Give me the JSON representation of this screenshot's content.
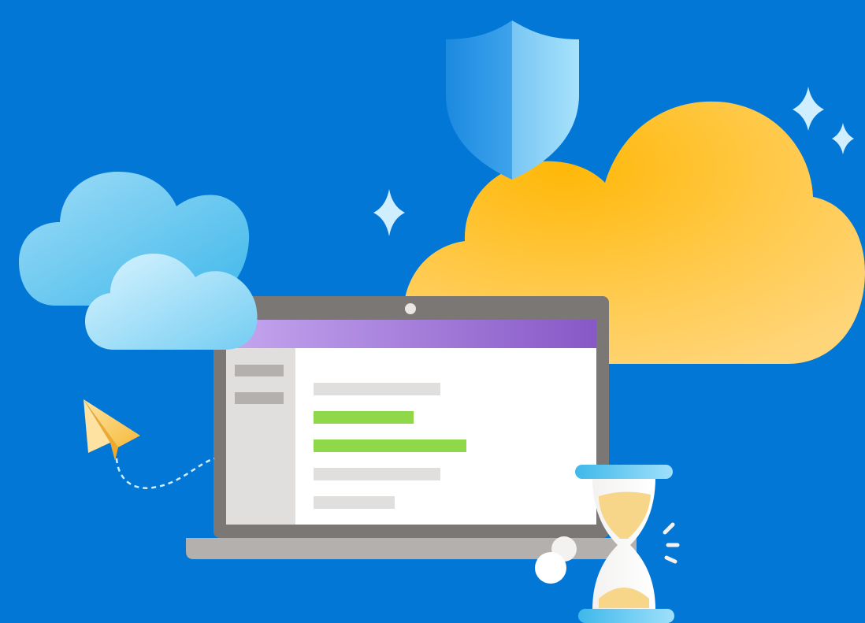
{
  "illustration": {
    "colors": {
      "background": "#0277d6",
      "laptop_bezel": "#7a7775",
      "laptop_base": "#b3b0ad",
      "title_bar_start": "#c4a5ee",
      "title_bar_end": "#8a5cc8",
      "sidebar": "#e1dfdd",
      "sidebar_item": "#b3b0ad",
      "content_bg": "#ffffff",
      "line_gray": "#e1dfdd",
      "line_green": "#8fd84a",
      "cloud_yellow": "#ffbf1f",
      "cloud_blue": "#59c8f0",
      "shield_blue": "#4aa8ec",
      "sparkle": "#cfeeff",
      "hourglass_cap": "#63c9f2",
      "hourglass_sand": "#f7d68a",
      "paper_plane": "#fcd06b"
    },
    "icons": [
      "shield-icon",
      "sparkle-icon",
      "cloud-icon",
      "laptop-icon",
      "paper-plane-icon",
      "hourglass-icon"
    ]
  }
}
